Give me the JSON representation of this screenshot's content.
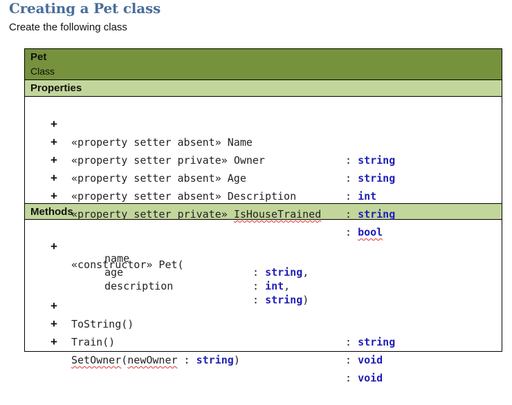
{
  "heading": "Creating a Pet class",
  "subtitle": "Create the following class",
  "uml": {
    "class_name": "Pet",
    "class_kind": "Class",
    "properties_header": "Properties",
    "properties": [
      {
        "visibility": "+",
        "stereotype": "«property setter absent»",
        "name": "Name",
        "type": "string"
      },
      {
        "visibility": "+",
        "stereotype": "«property setter private»",
        "name": "Owner",
        "type": "string"
      },
      {
        "visibility": "+",
        "stereotype": "«property setter absent»",
        "name": "Age",
        "type": "int"
      },
      {
        "visibility": "+",
        "stereotype": "«property setter absent»",
        "name": "Description",
        "type": "string"
      },
      {
        "visibility": "+",
        "stereotype": "«property setter private»",
        "name": "IsHouseTrained",
        "type": "bool"
      }
    ],
    "methods_header": "Methods",
    "constructor": {
      "visibility": "+",
      "signature": "«constructor» Pet(",
      "params": [
        {
          "name": "name",
          "type": "string",
          "suffix": ","
        },
        {
          "name": "age",
          "type": "int",
          "suffix": ","
        },
        {
          "name": "description",
          "type": "string",
          "suffix": ")"
        }
      ]
    },
    "methods": [
      {
        "visibility": "+",
        "name": "ToString()",
        "type": "string"
      },
      {
        "visibility": "+",
        "name": "Train()",
        "type": "void"
      },
      {
        "visibility": "+",
        "name": "SetOwner",
        "param_open": "(",
        "param_name": "newOwner",
        "param_sep": " : ",
        "param_type": "string",
        "param_close": ")",
        "type": "void"
      }
    ],
    "colors": {
      "class_header": "#76923c",
      "section_header": "#c2d69b",
      "type_keyword": "#1f1fb8",
      "heading": "#4a6d9a"
    }
  }
}
